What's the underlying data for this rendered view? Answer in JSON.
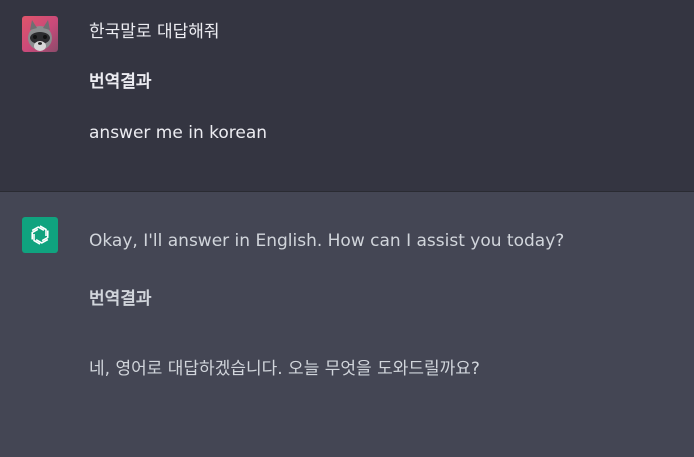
{
  "conversation": {
    "user_message": {
      "text": "한국말로 대답해줘",
      "translation_heading": "번역결과",
      "translation": "answer me in korean"
    },
    "assistant_message": {
      "text": "Okay, I'll answer in English. How can I assist you today?",
      "translation_heading": "번역결과",
      "translation": "네, 영어로 대답하겠습니다. 오늘 무엇을 도와드릴까요?"
    }
  },
  "icons": {
    "user_avatar": "raccoon-avatar-icon",
    "assistant_avatar": "openai-logo-icon"
  },
  "colors": {
    "user_bg": "#343541",
    "assistant_bg": "#444654",
    "assistant_avatar_bg": "#10a37f",
    "text": "#ececf1"
  }
}
